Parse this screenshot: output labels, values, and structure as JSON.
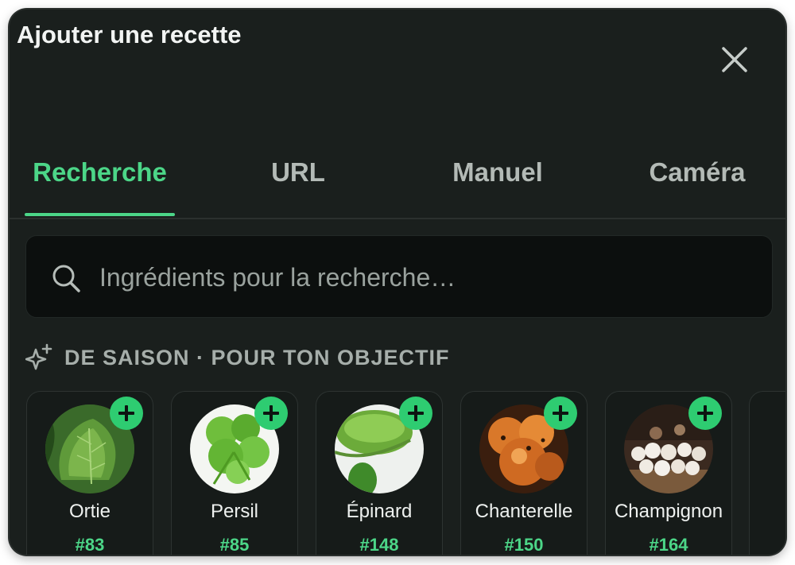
{
  "dialog": {
    "title": "Ajouter une recette",
    "close_icon": "close-icon"
  },
  "tabs": [
    {
      "label": "Recherche",
      "active": true
    },
    {
      "label": "URL",
      "active": false
    },
    {
      "label": "Manuel",
      "active": false
    },
    {
      "label": "Caméra",
      "active": false
    }
  ],
  "search": {
    "placeholder": "Ingrédients pour la recherche…",
    "value": "",
    "icon": "search-icon"
  },
  "seasonal": {
    "heading": "DE SAISON · POUR TON OBJECTIF",
    "icon": "sparkle-icon",
    "items": [
      {
        "name": "Ortie",
        "rank": "#83"
      },
      {
        "name": "Persil",
        "rank": "#85"
      },
      {
        "name": "Épinard",
        "rank": "#148"
      },
      {
        "name": "Chanterelle",
        "rank": "#150"
      },
      {
        "name": "Champignon",
        "rank": "#164"
      }
    ]
  },
  "colors": {
    "accent": "#4cd688",
    "background": "#1a1f1d",
    "add_button": "#2ecc71"
  }
}
